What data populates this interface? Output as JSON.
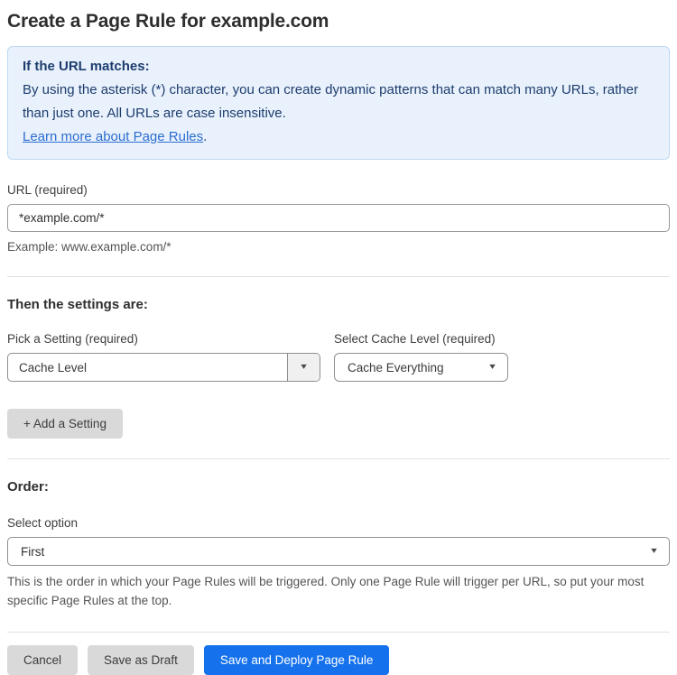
{
  "page": {
    "title": "Create a Page Rule for example.com"
  },
  "info_box": {
    "heading": "If the URL matches:",
    "body": "By using the asterisk (*) character, you can create dynamic patterns that can match many URLs, rather than just one. All URLs are case insensitive.",
    "link": "Learn more about Page Rules",
    "link_suffix": "."
  },
  "url_field": {
    "label": "URL (required)",
    "value": "*example.com/*",
    "helper": "Example: www.example.com/*"
  },
  "settings_section": {
    "heading": "Then the settings are:",
    "setting_label": "Pick a Setting (required)",
    "setting_value": "Cache Level",
    "cache_level_label": "Select Cache Level (required)",
    "cache_level_value": "Cache Everything",
    "add_button": "+ Add a Setting"
  },
  "order_section": {
    "heading": "Order:",
    "label": "Select option",
    "value": "First",
    "helper": "This is the order in which your Page Rules will be triggered. Only one Page Rule will trigger per URL, so put your most specific Page Rules at the top."
  },
  "footer": {
    "cancel": "Cancel",
    "save_draft": "Save as Draft",
    "save_deploy": "Save and Deploy Page Rule"
  },
  "icons": {
    "dropdown_arrow": "▾"
  },
  "colors": {
    "accent_blue": "#1672ec",
    "info_bg": "#e9f2fc",
    "info_border": "#bcd8f3",
    "info_text": "#1d3c6e",
    "link_blue": "#2c6cd1",
    "button_gray": "#d9d9d9"
  }
}
